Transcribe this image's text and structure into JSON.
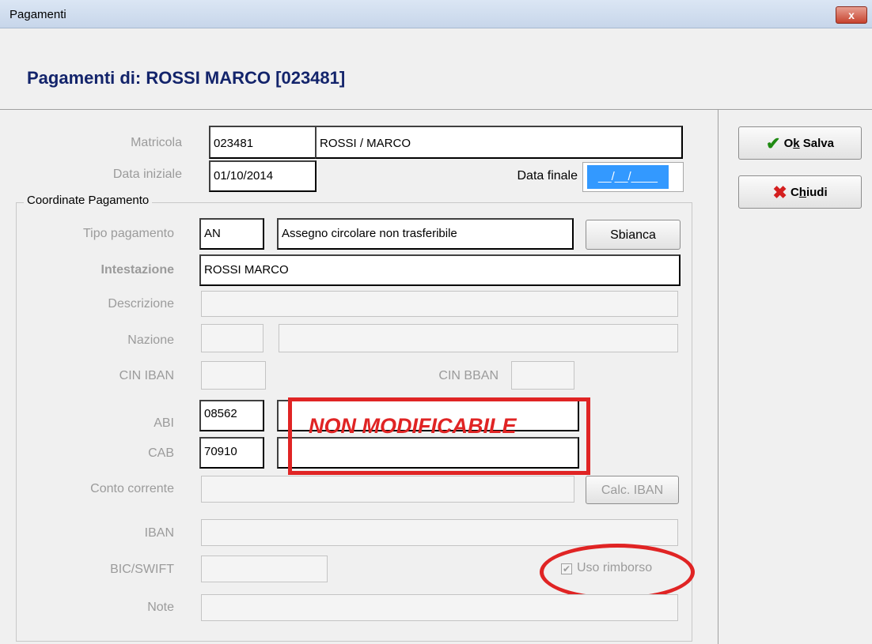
{
  "window": {
    "title": "Pagamenti",
    "close_glyph": "x"
  },
  "header": {
    "title": "Pagamenti di:  ROSSI MARCO [023481]"
  },
  "fields": {
    "matricola": {
      "label": "Matricola",
      "code": "023481",
      "name": "ROSSI / MARCO"
    },
    "data_iniziale": {
      "label": "Data iniziale",
      "value": "01/10/2014"
    },
    "data_finale": {
      "label": "Data finale",
      "value": "__/__/____"
    },
    "group_label": "Coordinate Pagamento",
    "tipo_pagamento": {
      "label": "Tipo pagamento",
      "code": "AN",
      "desc": "Assegno circolare non trasferibile"
    },
    "intestazione": {
      "label": "Intestazione",
      "value": "ROSSI MARCO"
    },
    "descrizione": {
      "label": "Descrizione",
      "value": ""
    },
    "nazione": {
      "label": "Nazione",
      "code": "",
      "desc": ""
    },
    "cin_iban": {
      "label": "CIN IBAN",
      "value": ""
    },
    "cin_bban": {
      "label": "CIN BBAN",
      "value": ""
    },
    "abi": {
      "label": "ABI",
      "code": "08562",
      "desc": ""
    },
    "cab": {
      "label": "CAB",
      "code": "70910",
      "desc": ""
    },
    "conto_corrente": {
      "label": "Conto corrente",
      "value": ""
    },
    "iban": {
      "label": "IBAN",
      "value": ""
    },
    "bic_swift": {
      "label": "BIC/SWIFT",
      "value": ""
    },
    "uso_rimborso": {
      "label": "Uso rimborso",
      "checked": true
    },
    "note": {
      "label": "Note",
      "value": ""
    }
  },
  "buttons": {
    "sbianca": "Sbianca",
    "calc_iban": "Calc. IBAN",
    "ok_salva": {
      "pre": "O",
      "mnemonic": "k",
      "post": " Salva"
    },
    "chiudi": {
      "pre": "C",
      "mnemonic": "h",
      "post": "iudi"
    }
  },
  "annotation": {
    "text": "NON MODIFICABILE"
  },
  "colors": {
    "title_blue": "#13246b",
    "annotation_red": "#e02424",
    "ok_green": "#1f8a12",
    "close_red": "#d41f1f"
  }
}
